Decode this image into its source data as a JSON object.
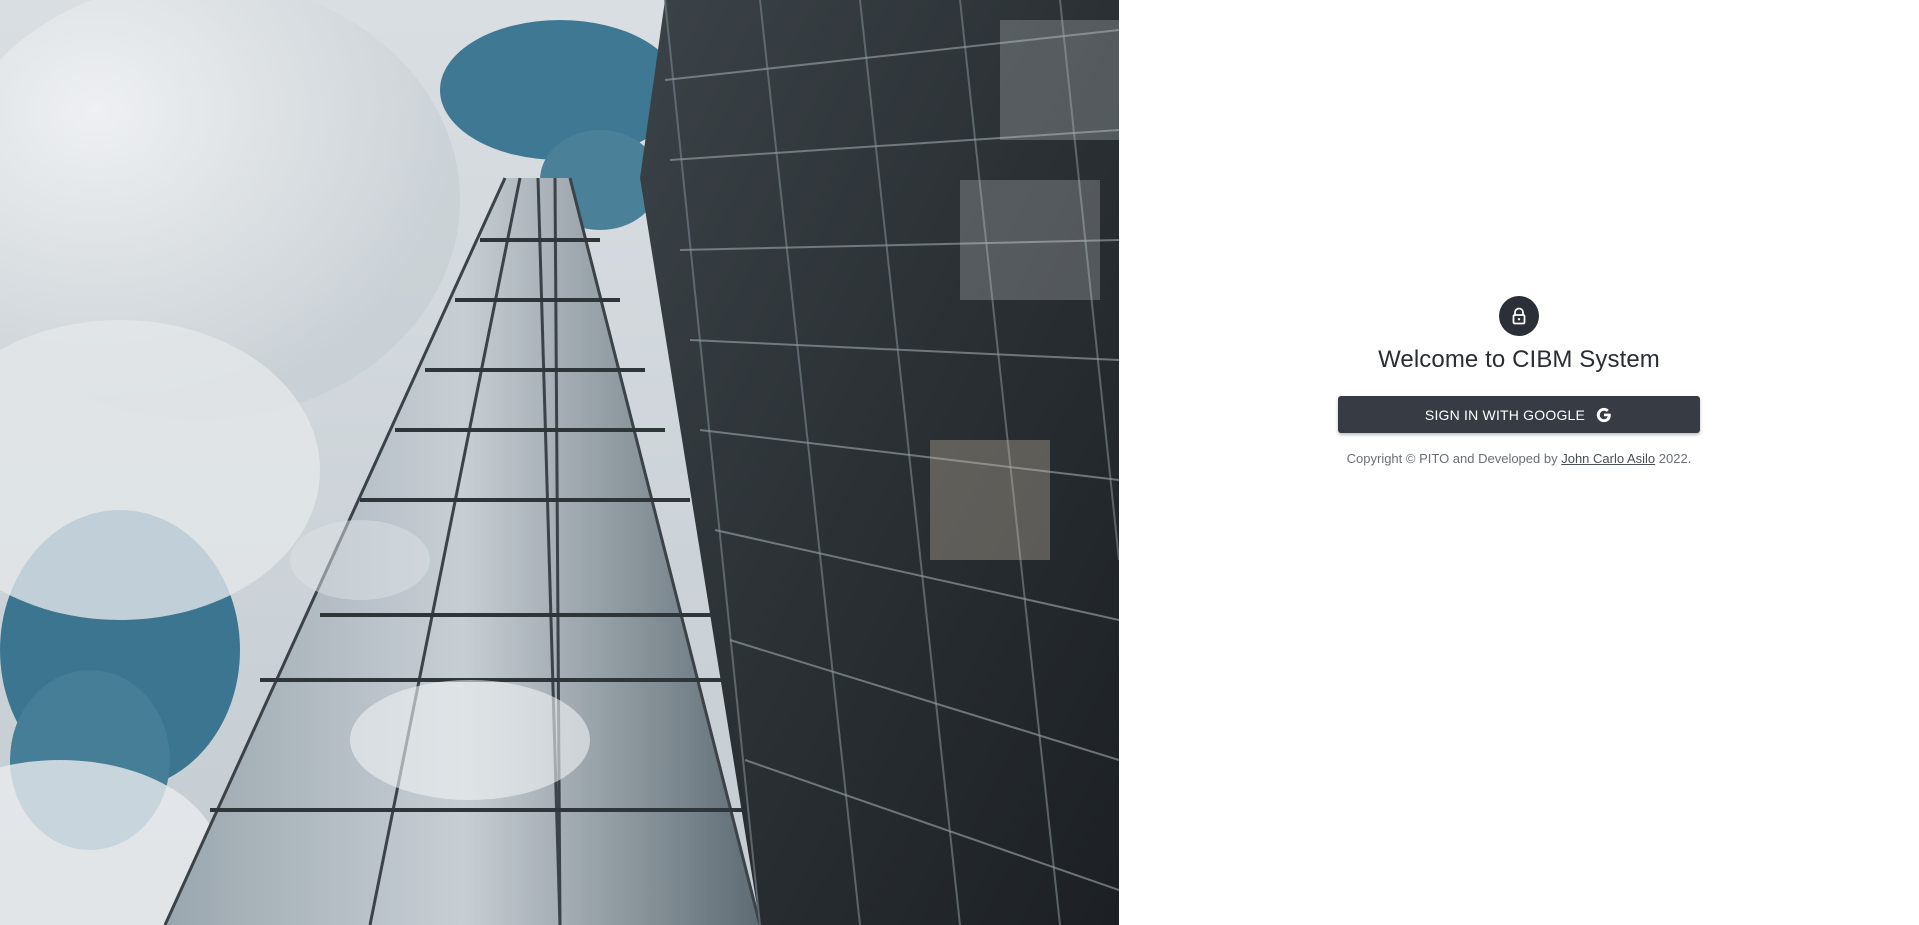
{
  "hero": {
    "image": "building-glass-facade-photo"
  },
  "signin": {
    "icon": "lock-icon",
    "title": "Welcome to CIBM System",
    "google_button_label": "SIGN IN WITH GOOGLE",
    "google_icon": "google-g-icon",
    "copyright_prefix": "Copyright © PITO and Developed by",
    "developer_name": "John Carlo Asilo",
    "copyright_suffix": "2022."
  },
  "colors": {
    "button_bg": "#363b44",
    "avatar_bg": "#2b3038",
    "sky": "#3f7a94"
  }
}
